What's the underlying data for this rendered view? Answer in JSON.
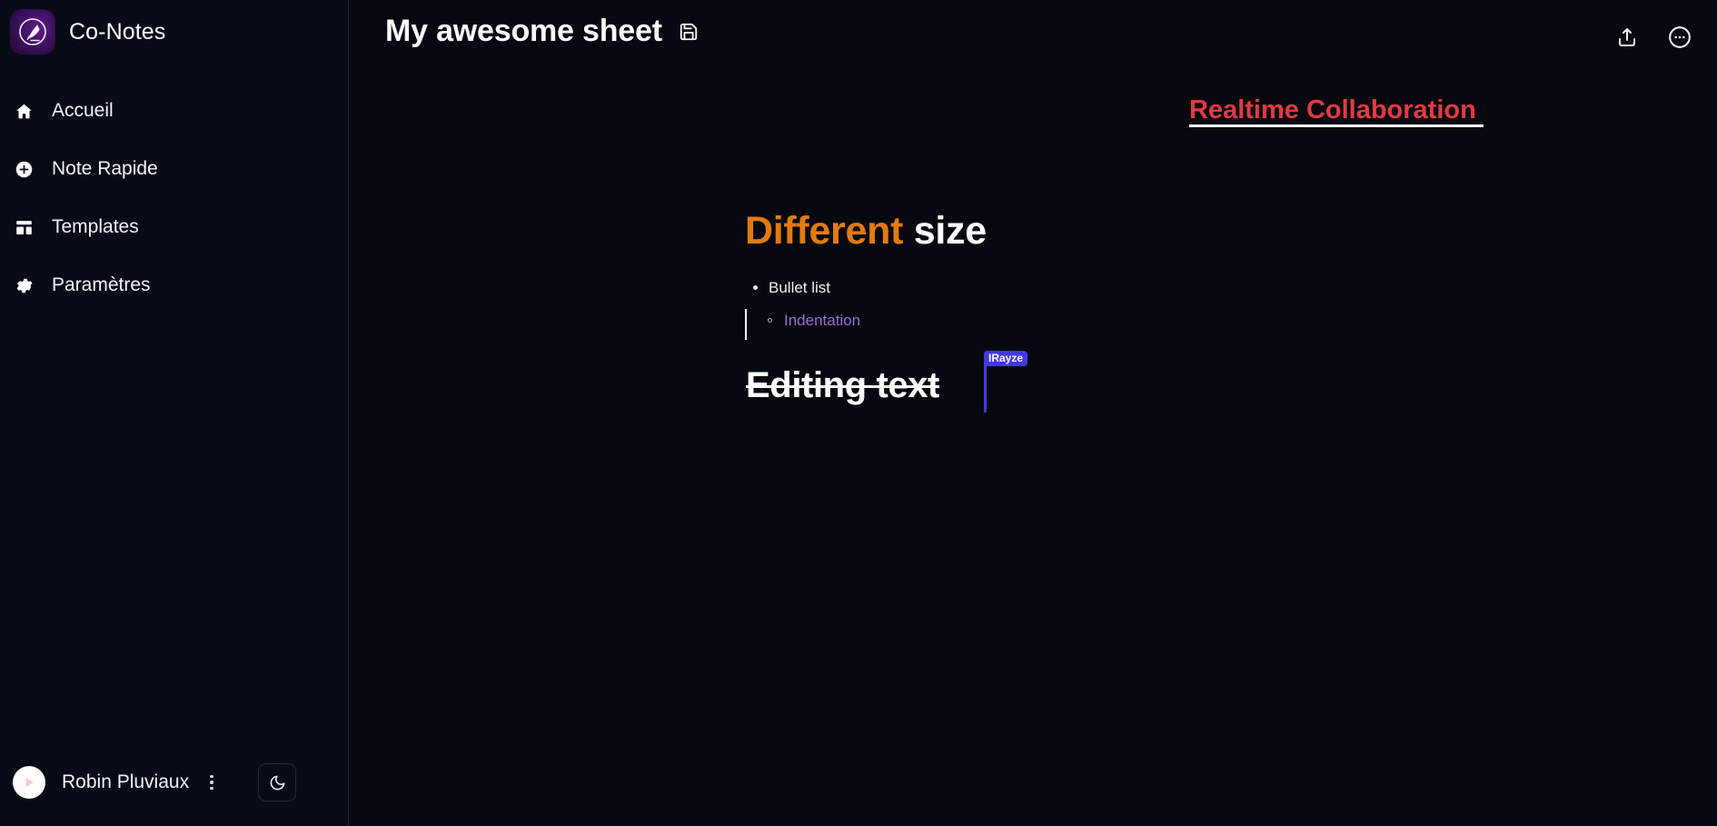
{
  "app": {
    "brand_name": "Co-Notes",
    "logo_icon": "quill-in-circle-logo"
  },
  "sidebar": {
    "items": [
      {
        "label": "Accueil",
        "icon": "home-icon"
      },
      {
        "label": "Note Rapide",
        "icon": "plus-circle-icon"
      },
      {
        "label": "Templates",
        "icon": "layout-template-icon"
      },
      {
        "label": "Paramètres",
        "icon": "gear-icon"
      }
    ],
    "footer": {
      "user_name": "Robin Pluviaux",
      "avatar_icon": "play-triangle-avatar",
      "user_menu_icon": "vertical-dots-icon",
      "theme_toggle_icon": "moon-icon"
    }
  },
  "topbar": {
    "doc_title": "My awesome sheet",
    "save_icon": "floppy-disk-save-icon",
    "share_icon": "share-upload-icon",
    "more_icon": "more-circle-icon"
  },
  "editor": {
    "collab_heading": "Realtime Collaboration ",
    "size_heading": {
      "word_colored": "Different",
      "word_plain": " size",
      "color": "#e07b12"
    },
    "bullet_list": {
      "item": "Bullet list",
      "indented_item": "Indentation",
      "indent_color": "#9a6ddb"
    },
    "strikethrough_text": "Editing text",
    "remote_cursor": {
      "label": "IRayze",
      "color": "#4338e8"
    }
  },
  "colors": {
    "background": "#05080f",
    "sidebar": "#070b16",
    "accent_red": "#e03b43",
    "accent_orange": "#e07b12",
    "accent_purple": "#9a6ddb",
    "cursor_indigo": "#4338e8"
  }
}
